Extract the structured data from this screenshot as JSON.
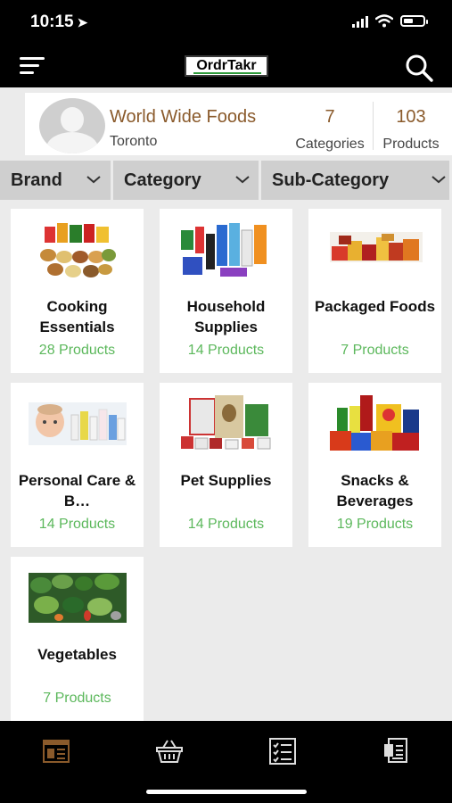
{
  "status_bar": {
    "time": "10:15",
    "location_glyph": "➤"
  },
  "app": {
    "logo_text": "OrdrTakr"
  },
  "profile": {
    "company": "World Wide Foods",
    "city": "Toronto",
    "categories_count": "7",
    "categories_label": "Categories",
    "products_count": "103",
    "products_label": "Products"
  },
  "filters": [
    {
      "label": "Brand"
    },
    {
      "label": "Category"
    },
    {
      "label": "Sub-Category"
    }
  ],
  "categories": [
    {
      "name": "Cooking Essentials",
      "count": "28 Products",
      "icon": "spices-image"
    },
    {
      "name": "Household Supplies",
      "count": "14 Products",
      "icon": "cleaners-image"
    },
    {
      "name": "Packaged Foods",
      "count": "7 Products",
      "icon": "boxes-image"
    },
    {
      "name": "Personal Care & B…",
      "count": "14 Products",
      "icon": "baby-care-image"
    },
    {
      "name": "Pet Supplies",
      "count": "14 Products",
      "icon": "pet-food-image"
    },
    {
      "name": "Snacks & Beverages",
      "count": "19 Products",
      "icon": "snacks-image"
    },
    {
      "name": "Vegetables",
      "count": "7 Products",
      "icon": "vegetables-image"
    }
  ],
  "tabs": [
    {
      "icon": "catalog-icon",
      "active": true
    },
    {
      "icon": "basket-icon",
      "active": false
    },
    {
      "icon": "checklist-icon",
      "active": false
    },
    {
      "icon": "orders-icon",
      "active": false
    }
  ],
  "colors": {
    "accent": "#8a5a2b",
    "count_green": "#5cb85c",
    "filter_bg": "#cfcfcf",
    "active_tab": "#8a5a2b"
  }
}
